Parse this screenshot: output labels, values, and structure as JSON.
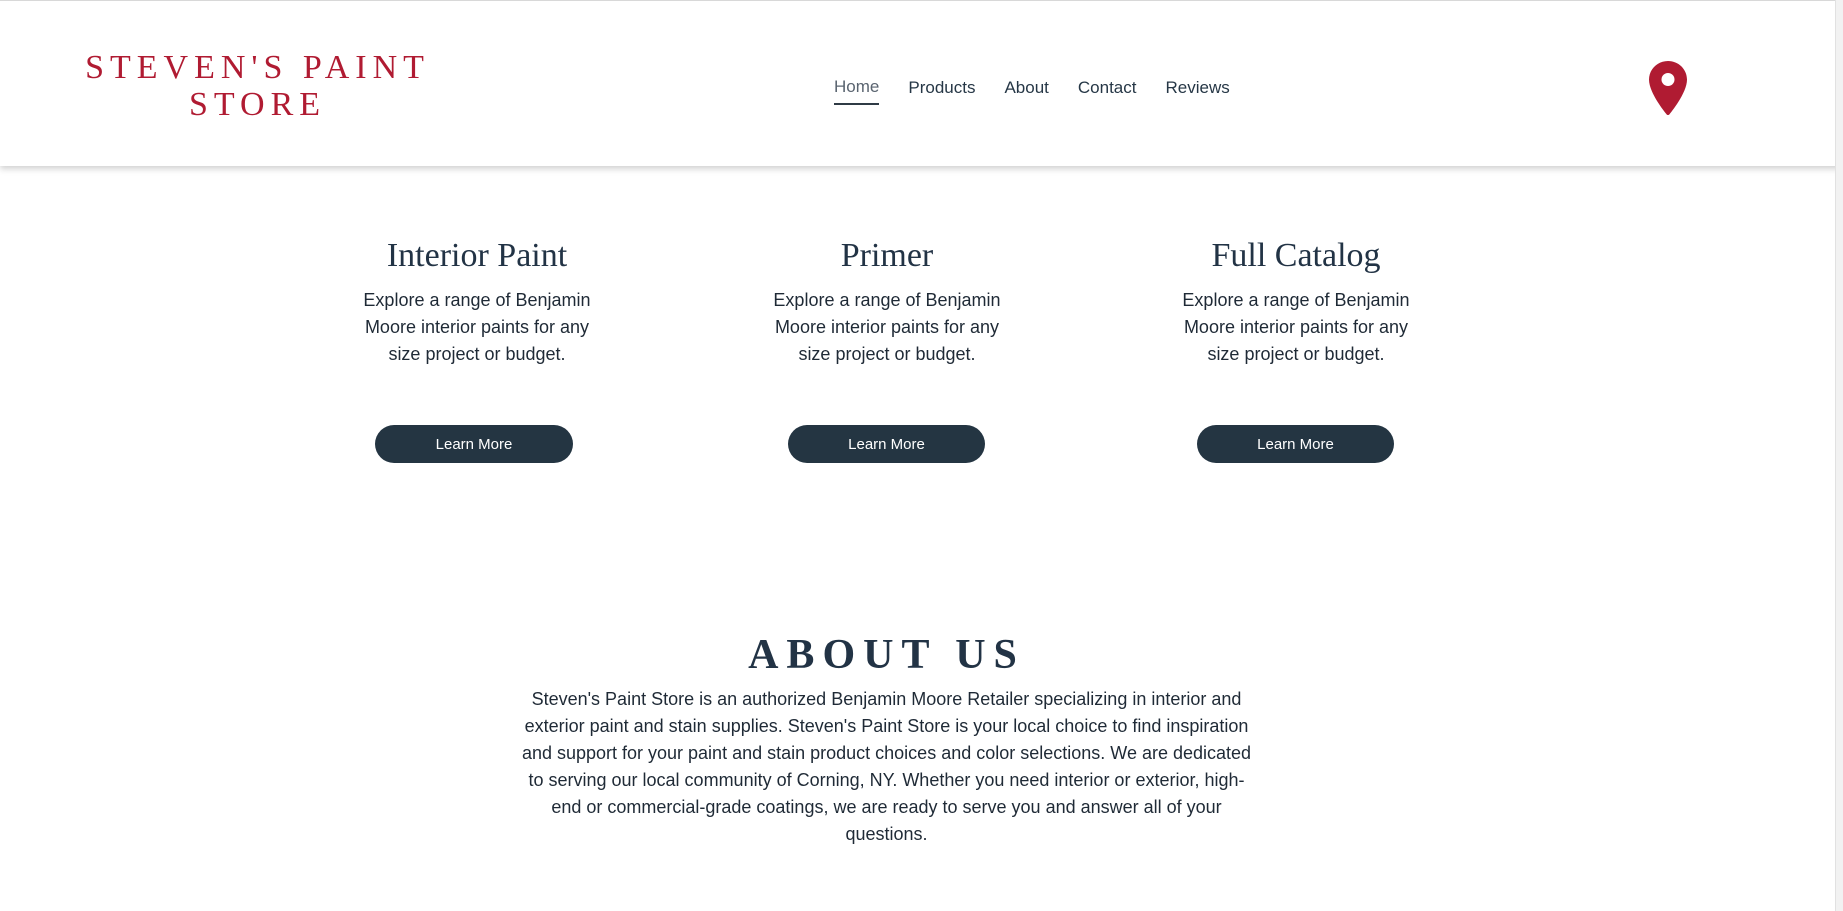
{
  "header": {
    "brand": "STEVEN'S PAINT STORE",
    "nav": [
      "Home",
      "Products",
      "About",
      "Contact",
      "Reviews"
    ],
    "active_nav": "Home",
    "location_icon": "map-pin-icon"
  },
  "products": [
    {
      "title": "Interior Paint",
      "description": "Explore a range of Benjamin Moore interior paints for any size project or budget.",
      "button": "Learn More"
    },
    {
      "title": "Primer",
      "description": "Explore a range of Benjamin Moore interior paints for any size project or budget.",
      "button": "Learn More"
    },
    {
      "title": "Full Catalog",
      "description": "Explore a range of Benjamin Moore interior paints for any size project or budget.",
      "button": "Learn More"
    }
  ],
  "about": {
    "title": "ABOUT US",
    "text": "Steven's Paint Store is an authorized Benjamin Moore Retailer specializing in interior and exterior paint and stain supplies. Steven's Paint Store is your local choice to find inspiration and support for your paint and stain product choices and color selections. We are dedicated to serving our local community of Corning, NY. Whether you need interior or exterior, high-end or commercial-grade coatings, we are ready to serve you and answer all of your questions."
  },
  "colors": {
    "brand_red": "#b01b32",
    "navy": "#243542",
    "text": "#1f2a36"
  }
}
